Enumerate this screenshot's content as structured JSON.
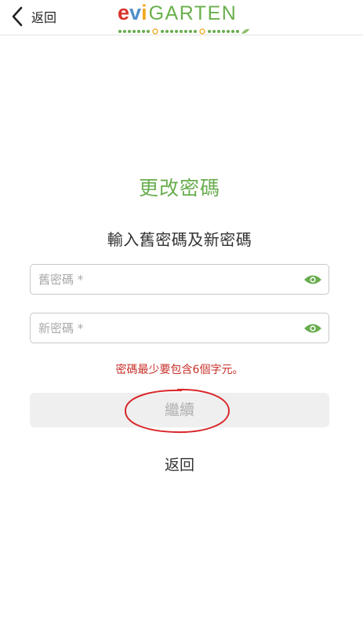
{
  "header": {
    "back_label": "返回",
    "logo": {
      "e": "e",
      "v": "v",
      "i": "i",
      "rest": "GARTEN"
    }
  },
  "main": {
    "title": "更改密碼",
    "subtitle": "輸入舊密碼及新密碼",
    "old_password": {
      "placeholder": "舊密碼 *",
      "value": ""
    },
    "new_password": {
      "placeholder": "新密碼 *",
      "value": ""
    },
    "error_message": "密碼最少要包含6個字元。",
    "continue_label": "繼續",
    "return_label": "返回"
  },
  "colors": {
    "brand_green": "#69ad4f",
    "error_red": "#c8302a",
    "annotation_red": "#d9262a",
    "disabled_bg": "#efefef",
    "disabled_text": "#b0b0b0"
  },
  "icons": {
    "back": "chevron-left-icon",
    "show_password": "eye-icon"
  }
}
